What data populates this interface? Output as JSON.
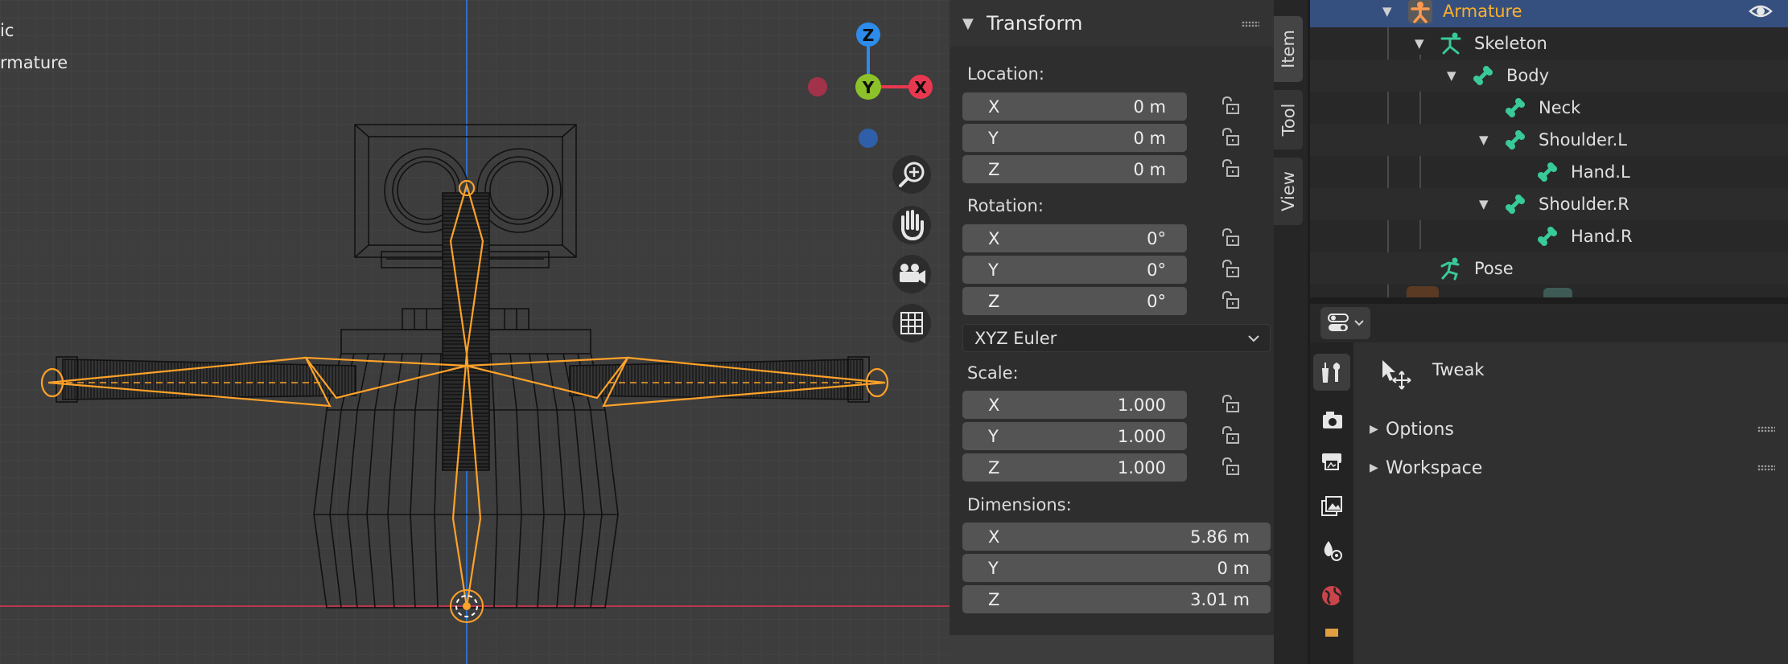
{
  "viewport": {
    "overlay_lines": [
      "ic",
      "rmature"
    ],
    "gizmo": {
      "z_label": "Z",
      "y_label": "Y",
      "x_label": "X"
    },
    "colors": {
      "x_axis": "#e8384f",
      "y_axis": "#8cc12a",
      "z_axis": "#2d8ceb",
      "bone": "#ffa229",
      "wire": "#111111",
      "grid": "#474747"
    },
    "nav_icons": [
      "zoom-icon",
      "hand-pan-icon",
      "camera-icon",
      "grid-icon"
    ]
  },
  "transform": {
    "title": "Transform",
    "location": {
      "label": "Location:",
      "fields": [
        {
          "axis": "X",
          "value": "0 m"
        },
        {
          "axis": "Y",
          "value": "0 m"
        },
        {
          "axis": "Z",
          "value": "0 m"
        }
      ]
    },
    "rotation": {
      "label": "Rotation:",
      "fields": [
        {
          "axis": "X",
          "value": "0°"
        },
        {
          "axis": "Y",
          "value": "0°"
        },
        {
          "axis": "Z",
          "value": "0°"
        }
      ],
      "mode": "XYZ Euler"
    },
    "scale": {
      "label": "Scale:",
      "fields": [
        {
          "axis": "X",
          "value": "1.000"
        },
        {
          "axis": "Y",
          "value": "1.000"
        },
        {
          "axis": "Z",
          "value": "1.000"
        }
      ]
    },
    "dimensions": {
      "label": "Dimensions:",
      "fields": [
        {
          "axis": "X",
          "value": "5.86 m"
        },
        {
          "axis": "Y",
          "value": "0 m"
        },
        {
          "axis": "Z",
          "value": "3.01 m"
        }
      ]
    }
  },
  "tabs": [
    "Item",
    "Tool",
    "View"
  ],
  "outliner": {
    "rows": [
      {
        "label": "Armature",
        "icon": "armature-icon"
      },
      {
        "label": "Skeleton",
        "icon": "armature-data-icon"
      },
      {
        "label": "Body",
        "icon": "bone-icon"
      },
      {
        "label": "Neck",
        "icon": "bone-icon"
      },
      {
        "label": "Shoulder.L",
        "icon": "bone-icon"
      },
      {
        "label": "Hand.L",
        "icon": "bone-icon"
      },
      {
        "label": "Shoulder.R",
        "icon": "bone-icon"
      },
      {
        "label": "Hand.R",
        "icon": "bone-icon"
      },
      {
        "label": "Pose",
        "icon": "pose-icon"
      }
    ],
    "colors": {
      "selected_row": "#35507f",
      "selected_text": "#ffaf29",
      "bone_icon": "#39c99a"
    }
  },
  "properties": {
    "tool_name": "Tweak",
    "sections": [
      "Options",
      "Workspace"
    ]
  }
}
